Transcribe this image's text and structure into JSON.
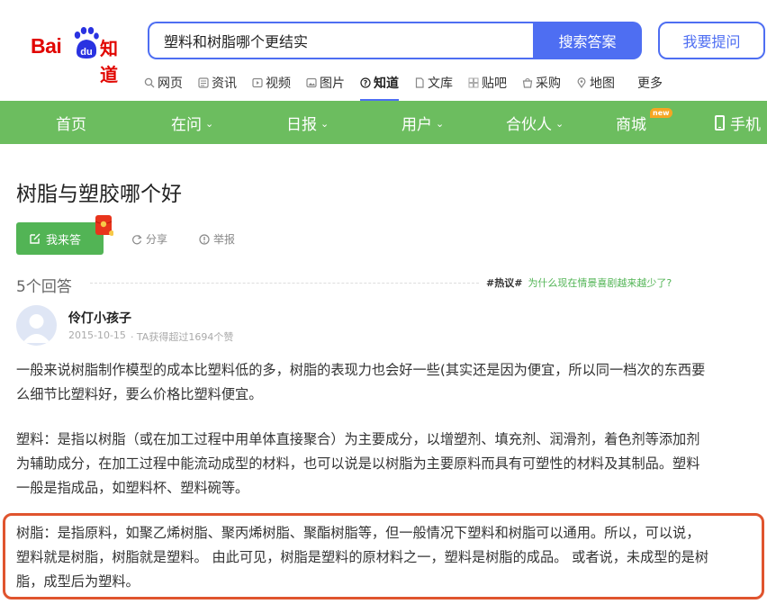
{
  "logo": {
    "bai": "Bai",
    "du": "du",
    "zhidao": "知道"
  },
  "search": {
    "query": "塑料和树脂哪个更结实",
    "button_label": "搜索答案"
  },
  "ask_button": "我要提问",
  "subnav": [
    {
      "label": "网页",
      "icon": "search-icon"
    },
    {
      "label": "资讯",
      "icon": "news-icon"
    },
    {
      "label": "视频",
      "icon": "video-icon"
    },
    {
      "label": "图片",
      "icon": "image-icon"
    },
    {
      "label": "知道",
      "icon": "question-icon",
      "active": true
    },
    {
      "label": "文库",
      "icon": "doc-icon"
    },
    {
      "label": "贴吧",
      "icon": "tieba-icon"
    },
    {
      "label": "采购",
      "icon": "shop-icon"
    },
    {
      "label": "地图",
      "icon": "map-icon"
    },
    {
      "label": "更多"
    }
  ],
  "menu": {
    "home": "首页",
    "zaiwen": "在问",
    "ribao": "日报",
    "yonghu": "用户",
    "huoban": "合伙人",
    "shangcheng": "商城",
    "new_badge": "new",
    "shouji": "手机"
  },
  "question": {
    "title": "树脂与塑胶哪个好",
    "answer_button": "我来答",
    "share": "分享",
    "report": "举报"
  },
  "answers": {
    "count_label": "5个回答",
    "hot_tag": "#热议#",
    "hot_link": "为什么现在情景喜剧越来越少了?"
  },
  "answer": {
    "author": "伶仃小孩子",
    "date": "2015-10-15",
    "likes": "· TA获得超过1694个赞",
    "paragraphs": [
      "一般来说树脂制作模型的成本比塑料低的多，树脂的表现力也会好一些(其实还是因为便宜，所以同一档次的东西要么细节比塑料好，要么价格比塑料便宜。",
      "塑料：是指以树脂（或在加工过程中用单体直接聚合）为主要成分，以增塑剂、填充剂、润滑剂，着色剂等添加剂为辅助成分，在加工过程中能流动成型的材料，也可以说是以树脂为主要原料而具有可塑性的材料及其制品。塑料一般是指成品，如塑料杯、塑料碗等。",
      "树脂：是指原料，如聚乙烯树脂、聚丙烯树脂、聚酯树脂等，但一般情况下塑料和树脂可以通用。所以，可以说，塑料就是树脂，树脂就是塑料。 由此可见，树脂是塑料的原材料之一，塑料是树脂的成品。 或者说，未成型的是树脂，成型后为塑料。"
    ]
  },
  "colors": {
    "brand_red": "#e10601",
    "brand_blue": "#4e6ef2",
    "menu_green": "#6cbd5f",
    "highlight_border": "#e0542e"
  }
}
